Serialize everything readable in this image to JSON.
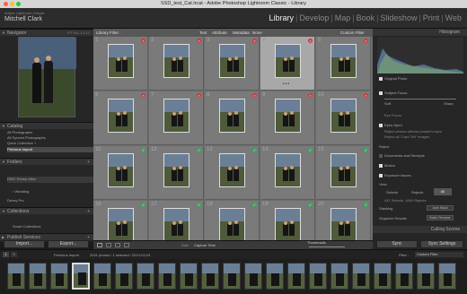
{
  "window": {
    "title": "SSD_test_Cat.lrcat - Adobe Photoshop Lightroom Classic - Library"
  },
  "identity": {
    "line1": "Adobe Lightroom Classic",
    "line2": "Mitchell Clark"
  },
  "modules": [
    "Library",
    "Develop",
    "Map",
    "Book",
    "Slideshow",
    "Print",
    "Web"
  ],
  "navigator": {
    "title": "Navigator",
    "zoom": "FIT  FILL  1:1  3:1"
  },
  "catalog": {
    "title": "Catalog",
    "items": [
      {
        "label": "All Photographs",
        "count": "2041"
      },
      {
        "label": "All Synced Photographs",
        "count": "0"
      },
      {
        "label": "Quick Collection +",
        "count": "0"
      },
      {
        "label": "Previous Import",
        "count": "2041"
      }
    ]
  },
  "folders": {
    "title": "Folders",
    "volume": "DWC Drivey Ultra",
    "volume_size": "1.8 / 1.8 TB",
    "folder": "Wedding",
    "folder_count": "2041",
    "extra": "Drivey Pro"
  },
  "collections": {
    "title": "Collections",
    "item": "Smart Collections"
  },
  "publish": {
    "title": "Publish Services"
  },
  "buttons": {
    "import": "Import...",
    "export": "Export..."
  },
  "filterbar": {
    "label": "Library Filter :",
    "text": "Text",
    "attribute": "Attribute",
    "metadata": "Metadata",
    "none": "None",
    "custom": "Custom Filter"
  },
  "histogram": {
    "title": "Histogram",
    "original": "Original Photo"
  },
  "right_panel": {
    "subject_focus": "Subject Focus",
    "soft": "Soft",
    "sharp": "Sharp",
    "eye_focus": "Eye Focus",
    "eyes_open": "Eyes Open",
    "eyes_note1": "Reject photos without people's eyes",
    "eyes_note2": "Reject all \"Card Tell\" images",
    "reject": "Reject",
    "dups": "Documents and Receipts",
    "motion": "Motion",
    "exposure": "Exposure Issues",
    "view": "View",
    "selects": "Selects",
    "rejects": "Rejects",
    "all": "All",
    "summary": "441 Selects, 1664 Rejects",
    "stacking": "Stacking",
    "auto_stack": "Auto Stack",
    "organize": "Organize Results",
    "batch_rename": "Batch Rename",
    "culling": "Culling Scores",
    "sync": "Sync",
    "sync_settings": "Sync Settings"
  },
  "toolbar": {
    "sort": "Sort:",
    "sort_value": "Capture Time",
    "thumbnails": "Thumbnails"
  },
  "filmstrip": {
    "pages": [
      "1",
      "2"
    ],
    "source": "Previous Import",
    "info": "2041 photos / 1 selected / 2024-03-03",
    "filter": "Filter :",
    "filter_value": "Custom Filter"
  },
  "grid_cells": [
    {
      "n": "1",
      "badge": "reject"
    },
    {
      "n": "2",
      "badge": "reject"
    },
    {
      "n": "3",
      "badge": "reject"
    },
    {
      "n": "4",
      "badge": "reject"
    },
    {
      "n": "5",
      "badge": "reject"
    },
    {
      "n": "6",
      "badge": "reject"
    },
    {
      "n": "7",
      "badge": "reject"
    },
    {
      "n": "8",
      "badge": "reject"
    },
    {
      "n": "9",
      "badge": "reject"
    },
    {
      "n": "10",
      "badge": "reject"
    },
    {
      "n": "11",
      "badge": "select"
    },
    {
      "n": "12",
      "badge": "select"
    },
    {
      "n": "13",
      "badge": "select"
    },
    {
      "n": "14",
      "badge": "select"
    },
    {
      "n": "15",
      "badge": "select"
    },
    {
      "n": "16",
      "badge": "select"
    },
    {
      "n": "17",
      "badge": "select"
    },
    {
      "n": "18",
      "badge": "select"
    },
    {
      "n": "19",
      "badge": "select"
    },
    {
      "n": "20",
      "badge": "select"
    }
  ],
  "colors": {
    "reject": "#d23a3a",
    "select": "#3aa65a",
    "accent": "#4a4a4a"
  }
}
